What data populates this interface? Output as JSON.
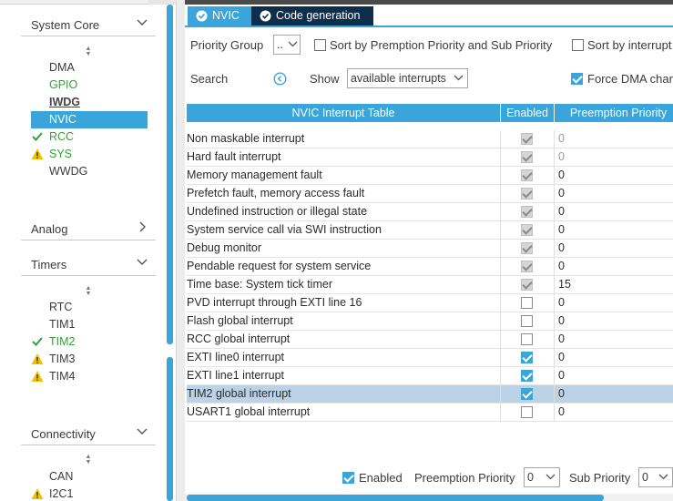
{
  "left_panel": {
    "categories": [
      {
        "title": "System Core",
        "expanded": true
      },
      {
        "title": "Analog",
        "expanded": false
      },
      {
        "title": "Timers",
        "expanded": true
      },
      {
        "title": "Connectivity",
        "expanded": true
      }
    ],
    "system_core_items": [
      {
        "label": "DMA",
        "status": "none"
      },
      {
        "label": "GPIO",
        "status": "configured"
      },
      {
        "label": "IWDG",
        "status": "active"
      },
      {
        "label": "NVIC",
        "status": "selected"
      },
      {
        "label": "RCC",
        "status": "ok"
      },
      {
        "label": "SYS",
        "status": "warning"
      },
      {
        "label": "WWDG",
        "status": "none"
      }
    ],
    "timers_items": [
      {
        "label": "RTC",
        "status": "none"
      },
      {
        "label": "TIM1",
        "status": "none"
      },
      {
        "label": "TIM2",
        "status": "ok"
      },
      {
        "label": "TIM3",
        "status": "warning"
      },
      {
        "label": "TIM4",
        "status": "warning"
      }
    ],
    "connectivity_items": [
      {
        "label": "CAN",
        "status": "none"
      },
      {
        "label": "I2C1",
        "status": "warning"
      }
    ]
  },
  "tabs": [
    {
      "label": "NVIC",
      "active": true
    },
    {
      "label": "Code generation",
      "active": false
    }
  ],
  "controls": {
    "priority_group_label": "Priority Group",
    "priority_group_value": "..",
    "sort_premption_label": "Sort by Premption Priority and Sub Priority",
    "sort_interrupt_label": "Sort by interrupt",
    "search_label": "Search",
    "show_label": "Show",
    "show_value": "available interrupts",
    "force_dma_label": "Force DMA char"
  },
  "table": {
    "headers": [
      "NVIC Interrupt Table",
      "Enabled",
      "Preemption Priority"
    ],
    "rows": [
      {
        "name": "Non maskable interrupt",
        "enabled": "forced",
        "priority": "0"
      },
      {
        "name": "Hard fault interrupt",
        "enabled": "forced",
        "priority": "0"
      },
      {
        "name": "Memory management fault",
        "enabled": "forced",
        "priority": "0"
      },
      {
        "name": "Prefetch fault, memory access fault",
        "enabled": "forced",
        "priority": "0"
      },
      {
        "name": "Undefined instruction or illegal state",
        "enabled": "forced",
        "priority": "0"
      },
      {
        "name": "System service call via SWI instruction",
        "enabled": "forced",
        "priority": "0"
      },
      {
        "name": "Debug monitor",
        "enabled": "forced",
        "priority": "0"
      },
      {
        "name": "Pendable request for system service",
        "enabled": "forced",
        "priority": "0"
      },
      {
        "name": "Time base: System tick timer",
        "enabled": "forced",
        "priority": "15"
      },
      {
        "name": "PVD interrupt through EXTI line 16",
        "enabled": "off",
        "priority": "0"
      },
      {
        "name": "Flash global interrupt",
        "enabled": "off",
        "priority": "0"
      },
      {
        "name": "RCC global interrupt",
        "enabled": "off",
        "priority": "0"
      },
      {
        "name": "EXTI line0 interrupt",
        "enabled": "on",
        "priority": "0"
      },
      {
        "name": "EXTI line1 interrupt",
        "enabled": "on",
        "priority": "0"
      },
      {
        "name": "TIM2 global interrupt",
        "enabled": "on",
        "priority": "0",
        "selected": true
      },
      {
        "name": "USART1 global interrupt",
        "enabled": "off",
        "priority": "0"
      }
    ]
  },
  "footer": {
    "enabled_label": "Enabled",
    "preemption_label": "Preemption Priority",
    "preemption_value": "0",
    "sub_label": "Sub Priority",
    "sub_value": "0"
  },
  "colors": {
    "accent": "#3aa5da",
    "tab_dark": "#0d2f4c",
    "ok_green": "#33a137",
    "warning_yellow": "#f2c200",
    "row_selected": "#bcd2e6"
  }
}
